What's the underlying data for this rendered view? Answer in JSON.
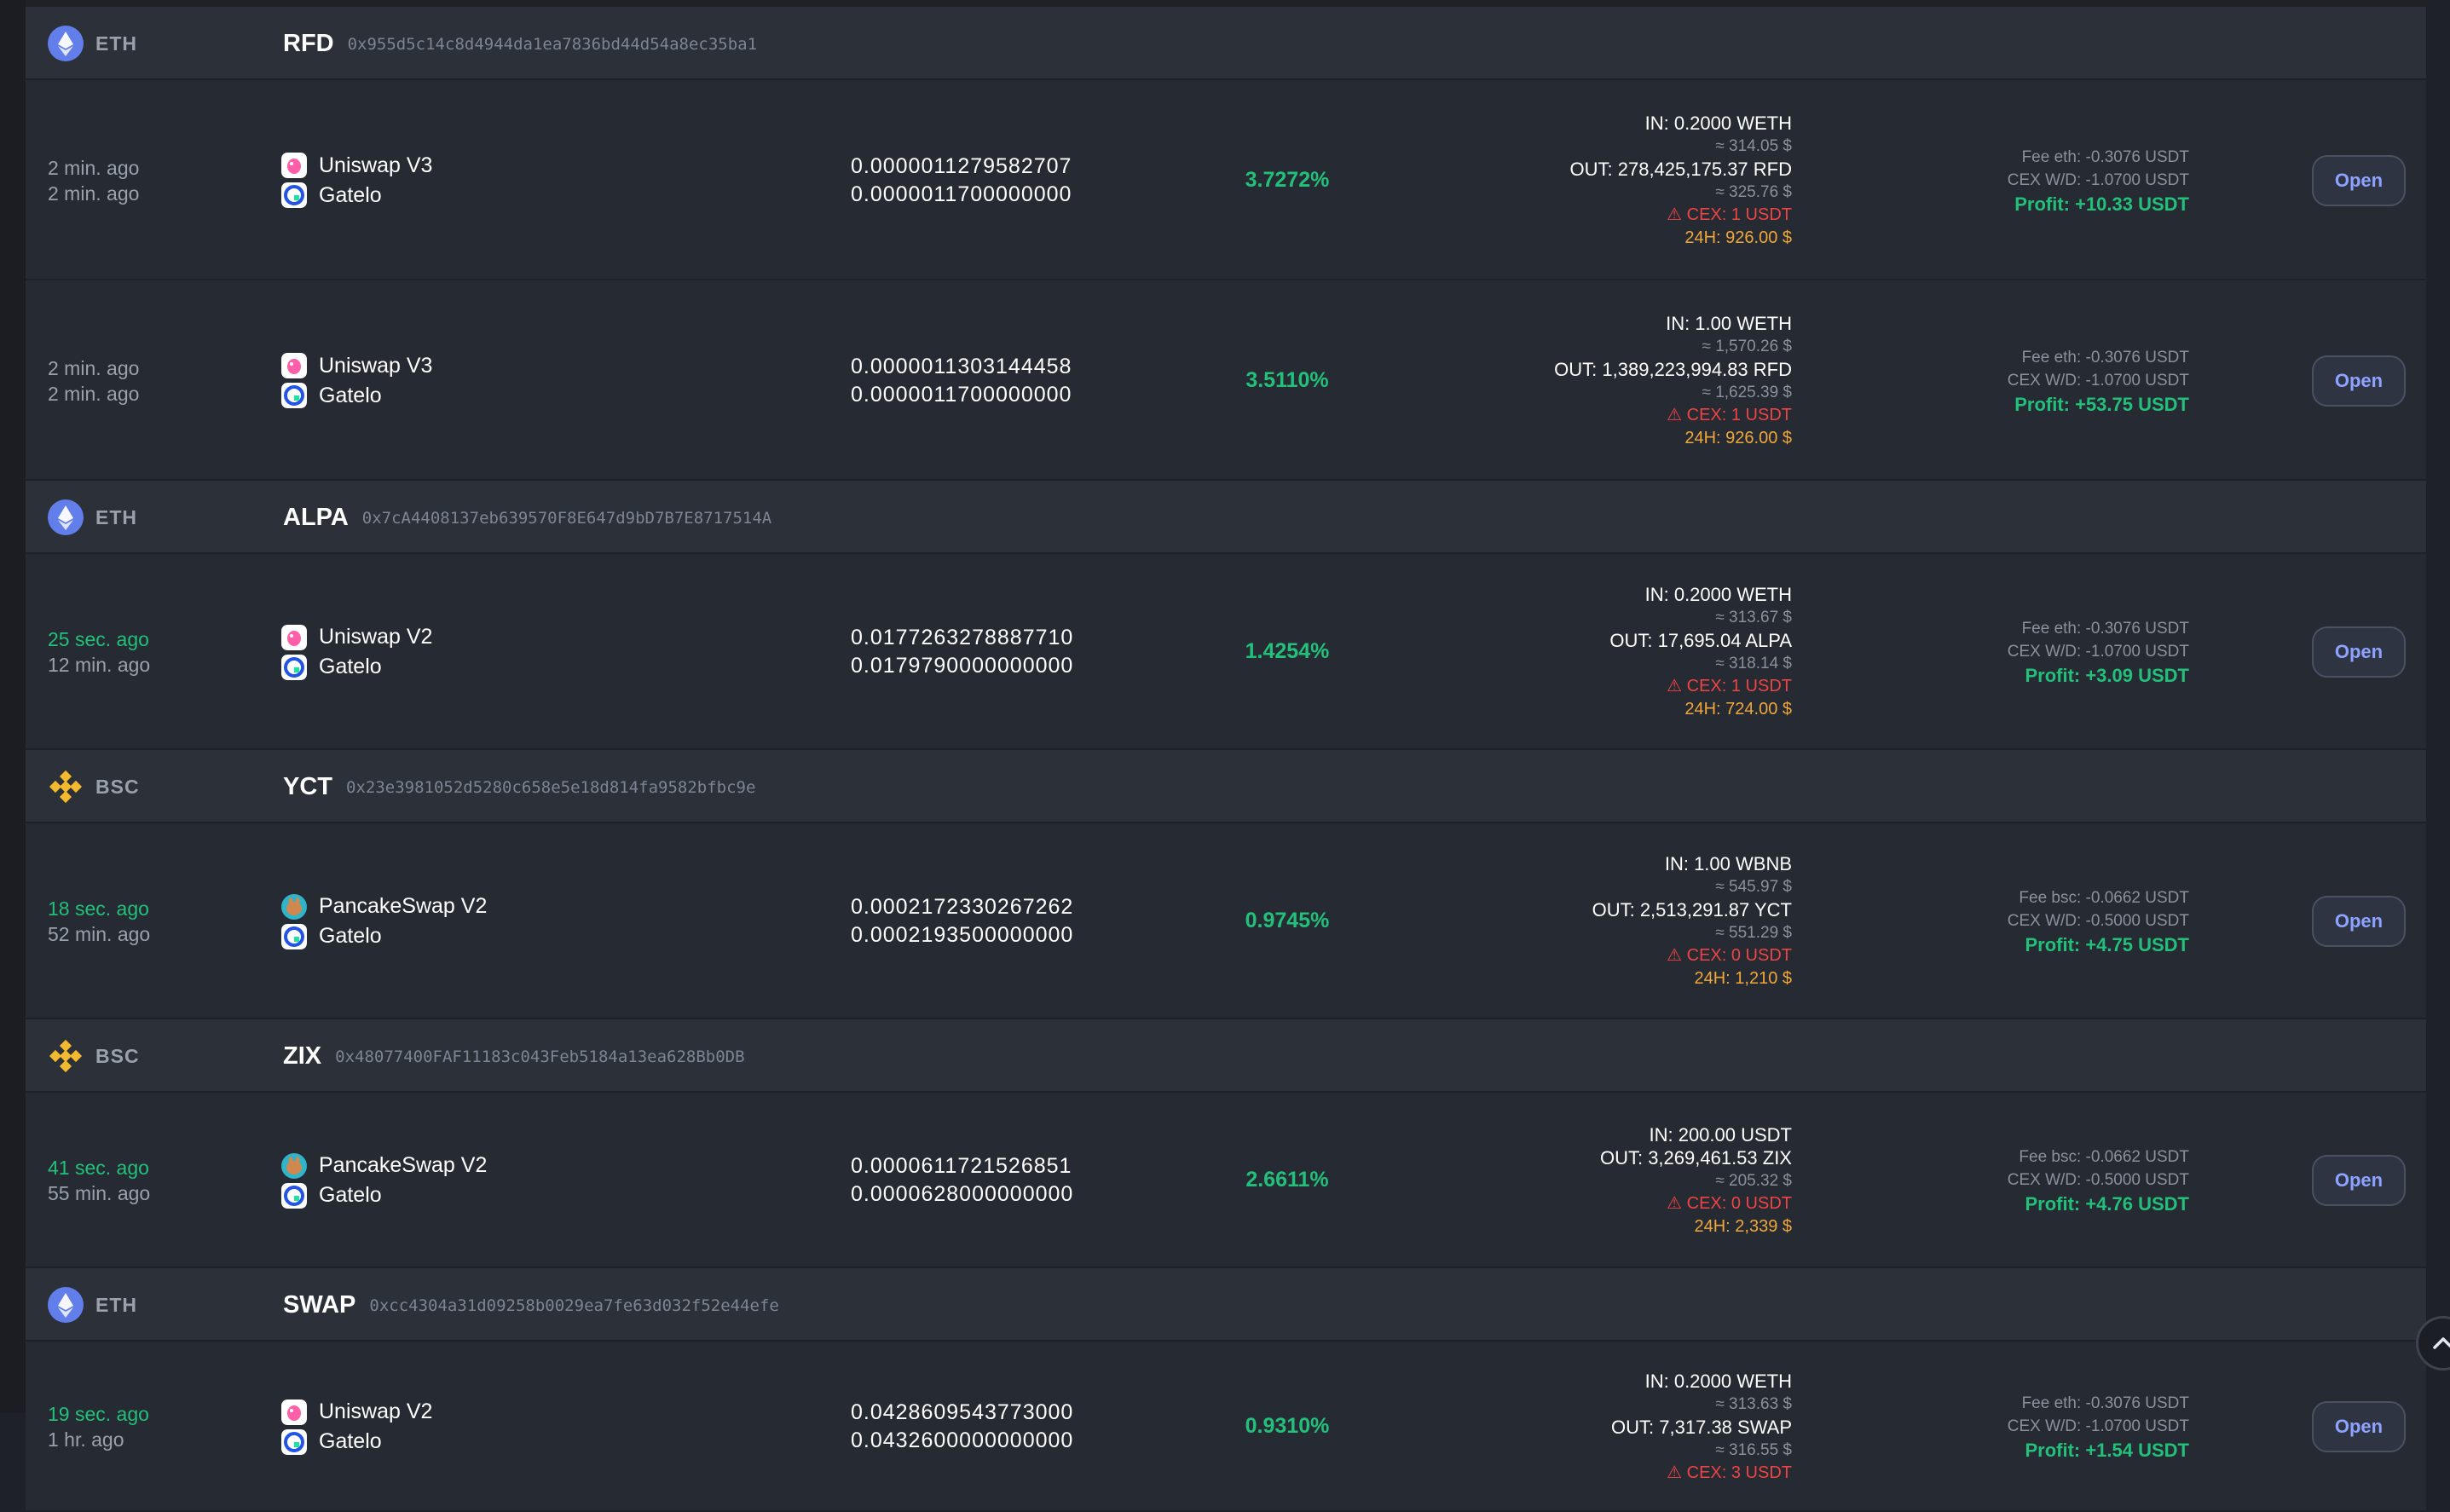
{
  "colors": {
    "background": "#1e2128",
    "row": "#262a32",
    "group_header": "#2c3038",
    "green": "#22c07a",
    "red": "#ef4444",
    "orange": "#f0a73b",
    "eth": "#627eea",
    "bsc": "#f3ba2f",
    "open_button_text": "#8ea2ff"
  },
  "open_label": "Open",
  "groups": [
    {
      "chain": "ETH",
      "chain_icon": "ethereum-icon",
      "token": "RFD",
      "address": "0x955d5c14c8d4944da1ea7836bd44d54a8ec35ba1",
      "rows": [
        {
          "time1": "2 min. ago",
          "time2": "2 min. ago",
          "time1_fresh": false,
          "dex1": "Uniswap V3",
          "dex1_icon": "uniswap-icon",
          "dex2": "Gatelo",
          "dex2_icon": "gate-icon",
          "price1": "0.0000011279582707",
          "price2": "0.0000011700000000",
          "spread": "3.7272%",
          "in": "IN: 0.2000 WETH",
          "in_usd": "≈ 314.05 $",
          "out": "OUT: 278,425,175.37 RFD",
          "out_usd": "≈ 325.76 $",
          "cex": "⚠ CEX: 1 USDT",
          "h24": "24H: 926.00 $",
          "fee": "Fee eth: -0.3076 USDT",
          "cex_wd": "CEX W/D: -1.0700 USDT",
          "profit": "Profit: +10.33 USDT"
        },
        {
          "time1": "2 min. ago",
          "time2": "2 min. ago",
          "time1_fresh": false,
          "dex1": "Uniswap V3",
          "dex1_icon": "uniswap-icon",
          "dex2": "Gatelo",
          "dex2_icon": "gate-icon",
          "price1": "0.0000011303144458",
          "price2": "0.0000011700000000",
          "spread": "3.5110%",
          "in": "IN: 1.00 WETH",
          "in_usd": "≈ 1,570.26 $",
          "out": "OUT: 1,389,223,994.83 RFD",
          "out_usd": "≈ 1,625.39 $",
          "cex": "⚠ CEX: 1 USDT",
          "h24": "24H: 926.00 $",
          "fee": "Fee eth: -0.3076 USDT",
          "cex_wd": "CEX W/D: -1.0700 USDT",
          "profit": "Profit: +53.75 USDT"
        }
      ]
    },
    {
      "chain": "ETH",
      "chain_icon": "ethereum-icon",
      "token": "ALPA",
      "address": "0x7cA4408137eb639570F8E647d9bD7B7E8717514A",
      "rows": [
        {
          "time1": "25 sec. ago",
          "time2": "12 min. ago",
          "time1_fresh": true,
          "dex1": "Uniswap V2",
          "dex1_icon": "uniswap-icon",
          "dex2": "Gatelo",
          "dex2_icon": "gate-icon",
          "price1": "0.0177263278887710",
          "price2": "0.0179790000000000",
          "spread": "1.4254%",
          "in": "IN: 0.2000 WETH",
          "in_usd": "≈ 313.67 $",
          "out": "OUT: 17,695.04 ALPA",
          "out_usd": "≈ 318.14 $",
          "cex": "⚠ CEX: 1 USDT",
          "h24": "24H: 724.00 $",
          "fee": "Fee eth: -0.3076 USDT",
          "cex_wd": "CEX W/D: -1.0700 USDT",
          "profit": "Profit: +3.09 USDT"
        }
      ]
    },
    {
      "chain": "BSC",
      "chain_icon": "bnb-chain-icon",
      "token": "YCT",
      "address": "0x23e3981052d5280c658e5e18d814fa9582bfbc9e",
      "rows": [
        {
          "time1": "18 sec. ago",
          "time2": "52 min. ago",
          "time1_fresh": true,
          "dex1": "PancakeSwap V2",
          "dex1_icon": "pancakeswap-icon",
          "dex2": "Gatelo",
          "dex2_icon": "gate-icon",
          "price1": "0.0002172330267262",
          "price2": "0.0002193500000000",
          "spread": "0.9745%",
          "in": "IN: 1.00 WBNB",
          "in_usd": "≈ 545.97 $",
          "out": "OUT: 2,513,291.87 YCT",
          "out_usd": "≈ 551.29 $",
          "cex": "⚠ CEX: 0 USDT",
          "h24": "24H: 1,210 $",
          "fee": "Fee bsc: -0.0662 USDT",
          "cex_wd": "CEX W/D: -0.5000 USDT",
          "profit": "Profit: +4.75 USDT"
        }
      ]
    },
    {
      "chain": "BSC",
      "chain_icon": "bnb-chain-icon",
      "token": "ZIX",
      "address": "0x48077400FAF11183c043Feb5184a13ea628Bb0DB",
      "rows": [
        {
          "time1": "41 sec. ago",
          "time2": "55 min. ago",
          "time1_fresh": true,
          "dex1": "PancakeSwap V2",
          "dex1_icon": "pancakeswap-icon",
          "dex2": "Gatelo",
          "dex2_icon": "gate-icon",
          "price1": "0.0000611721526851",
          "price2": "0.0000628000000000",
          "spread": "2.6611%",
          "in": "IN: 200.00 USDT",
          "in_usd": "",
          "out": "OUT: 3,269,461.53 ZIX",
          "out_usd": "≈ 205.32 $",
          "cex": "⚠ CEX: 0 USDT",
          "h24": "24H: 2,339 $",
          "fee": "Fee bsc: -0.0662 USDT",
          "cex_wd": "CEX W/D: -0.5000 USDT",
          "profit": "Profit: +4.76 USDT"
        }
      ]
    },
    {
      "chain": "ETH",
      "chain_icon": "ethereum-icon",
      "token": "SWAP",
      "address": "0xcc4304a31d09258b0029ea7fe63d032f52e44efe",
      "rows": [
        {
          "time1": "19 sec. ago",
          "time2": "1 hr. ago",
          "time1_fresh": true,
          "dex1": "Uniswap V2",
          "dex1_icon": "uniswap-icon",
          "dex2": "Gatelo",
          "dex2_icon": "gate-icon",
          "price1": "0.0428609543773000",
          "price2": "0.0432600000000000",
          "spread": "0.9310%",
          "in": "IN: 0.2000 WETH",
          "in_usd": "≈ 313.63 $",
          "out": "OUT: 7,317.38 SWAP",
          "out_usd": "≈ 316.55 $",
          "cex": "⚠ CEX: 3 USDT",
          "h24": "",
          "fee": "Fee eth: -0.3076 USDT",
          "cex_wd": "CEX W/D: -1.0700 USDT",
          "profit": "Profit: +1.54 USDT"
        }
      ]
    }
  ],
  "scroll_top_icon": "chevron-up-icon"
}
